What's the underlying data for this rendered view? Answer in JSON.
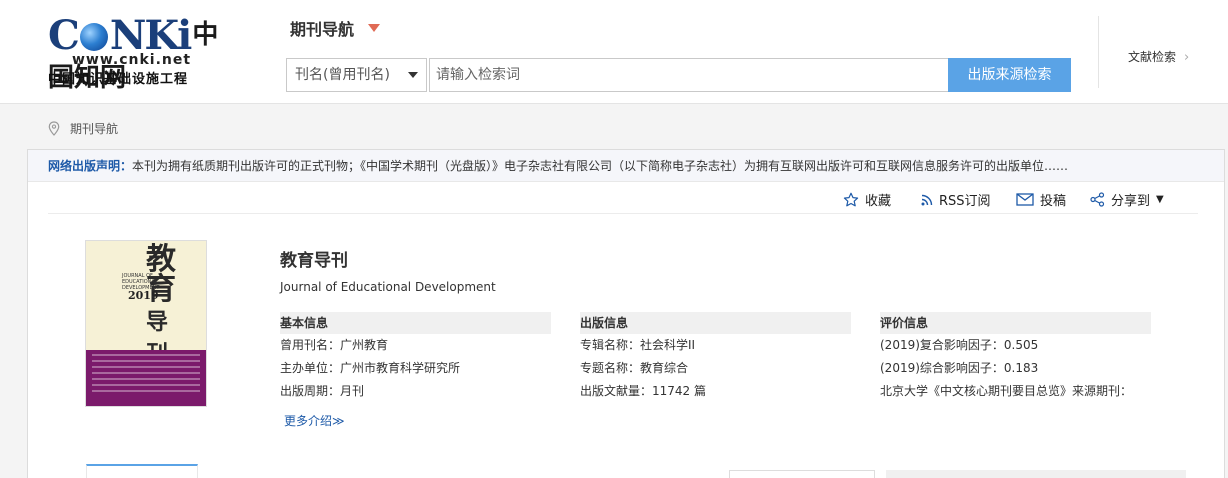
{
  "header": {
    "logo": {
      "brand": "CNKi",
      "brand_cn": "中国知网",
      "url": "www.cnki.net",
      "slogan": "中国知识基础设施工程"
    },
    "nav_title": "期刊导航",
    "search": {
      "select_value": "刊名(曾用刊名)",
      "placeholder": "请输入检索词",
      "button_label": "出版来源检索"
    },
    "doc_search_label": "文献检索"
  },
  "breadcrumb": {
    "label": "期刊导航"
  },
  "notice": {
    "label": "网络出版声明：",
    "text": "本刊为拥有纸质期刊出版许可的正式刊物；《中国学术期刊（光盘版）》电子杂志社有限公司（以下简称电子杂志社）为拥有互联网出版许可和互联网信息服务许可的出版单位……"
  },
  "toolbar": {
    "favorite": "收藏",
    "rss": "RSS订阅",
    "submit": "投稿",
    "share": "分享到"
  },
  "journal": {
    "title": "教育导刊",
    "title_en": "Journal of Educational Development",
    "cover": {
      "title_chars": "教育导刊",
      "year_issue": "2019"
    }
  },
  "basic_info": {
    "header": "基本信息",
    "rows": [
      {
        "label": "曾用刊名：",
        "value": "广州教育"
      },
      {
        "label": "主办单位：",
        "value": "广州市教育科学研究所"
      },
      {
        "label": "出版周期：",
        "value": "月刊"
      }
    ],
    "more": "更多介绍≫"
  },
  "pub_info": {
    "header": "出版信息",
    "rows": [
      {
        "label": "专辑名称：",
        "value": "社会科学II"
      },
      {
        "label": "专题名称：",
        "value": "教育综合"
      },
      {
        "label": "出版文献量：",
        "value": "11742 篇"
      }
    ]
  },
  "eval_info": {
    "header": "评价信息",
    "rows": [
      {
        "label": "(2019)复合影响因子：",
        "value": "0.505"
      },
      {
        "label": "(2019)综合影响因子：",
        "value": "0.183"
      },
      {
        "label": "北京大学《中文核心期刊要目总览》来源期刊：",
        "value": ""
      }
    ]
  },
  "colors": {
    "accent": "#5aa3e6",
    "link": "#1e5aa8",
    "nav_arrow": "#e06a55",
    "cover_band": "#7b1a6b"
  }
}
